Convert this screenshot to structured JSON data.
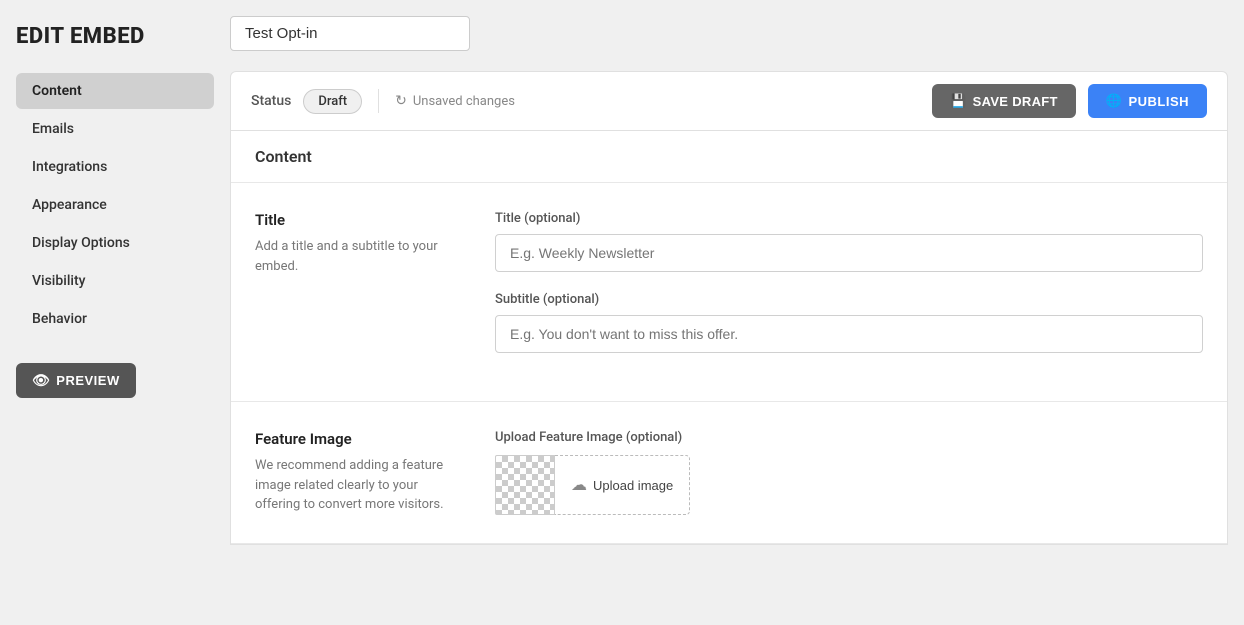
{
  "page": {
    "title": "EDIT EMBED"
  },
  "embed": {
    "name": "Test Opt-in"
  },
  "toolbar": {
    "status_label": "Status",
    "status_badge": "Draft",
    "unsaved_label": "Unsaved changes",
    "save_draft_label": "SAVE DRAFT",
    "publish_label": "PUBLISH"
  },
  "sidebar": {
    "items": [
      {
        "label": "Content",
        "active": true
      },
      {
        "label": "Emails",
        "active": false
      },
      {
        "label": "Integrations",
        "active": false
      },
      {
        "label": "Appearance",
        "active": false
      },
      {
        "label": "Display Options",
        "active": false
      },
      {
        "label": "Visibility",
        "active": false
      },
      {
        "label": "Behavior",
        "active": false
      }
    ],
    "preview_label": "PREVIEW"
  },
  "content": {
    "section_title": "Content",
    "title_section": {
      "heading": "Title",
      "description": "Add a title and a subtitle to your embed.",
      "title_label": "Title (optional)",
      "title_placeholder": "E.g. Weekly Newsletter",
      "subtitle_label": "Subtitle (optional)",
      "subtitle_placeholder": "E.g. You don't want to miss this offer."
    },
    "feature_image_section": {
      "heading": "Feature Image",
      "description": "We recommend adding a feature image related clearly to your offering to convert more visitors.",
      "upload_label": "Upload Feature Image (optional)",
      "upload_button_label": "Upload image"
    }
  }
}
